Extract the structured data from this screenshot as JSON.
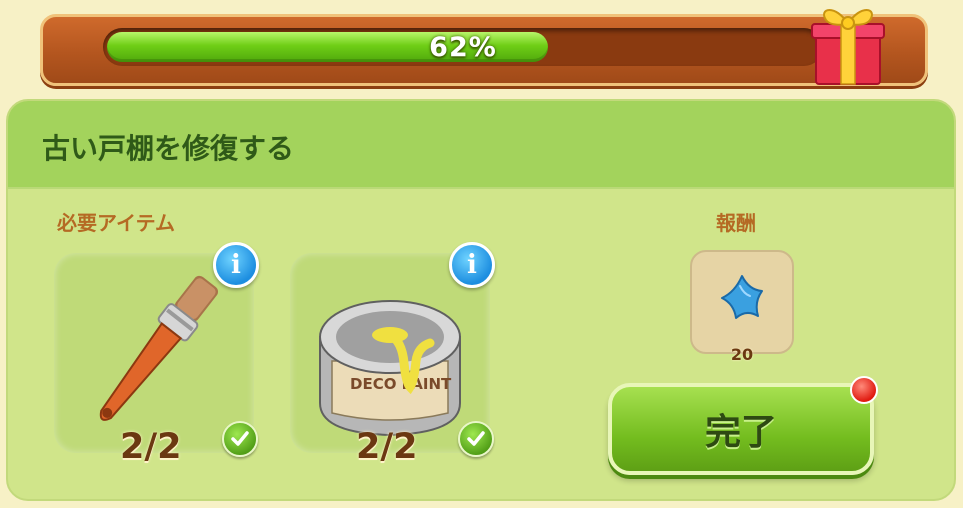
{
  "progress": {
    "percent": 62,
    "label": "62%"
  },
  "quest": {
    "title": "古い戸棚を修復する",
    "required_label": "必要アイテム",
    "reward_label": "報酬",
    "items": [
      {
        "icon": "paintbrush-icon",
        "count": "2/2",
        "complete": true
      },
      {
        "icon": "paint-can-icon",
        "count": "2/2",
        "complete": true
      }
    ],
    "reward": {
      "icon": "blue-star-icon",
      "amount": "20"
    },
    "complete_button": "完了"
  },
  "colors": {
    "accent_green": "#74bd1f",
    "progress_frame": "#c05f24",
    "info_blue": "#1d8ee0",
    "notify_red": "#e01a10"
  }
}
